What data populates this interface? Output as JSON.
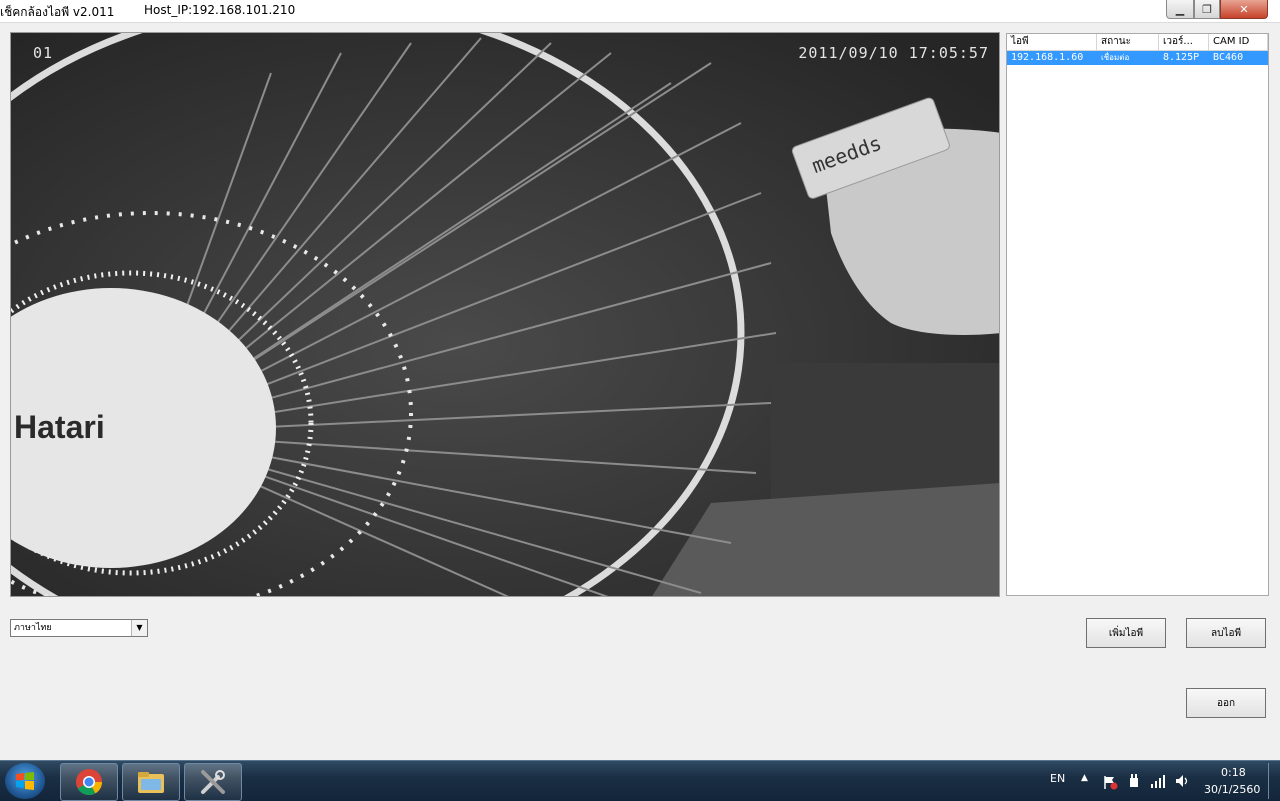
{
  "window": {
    "title": "เช็คกล้องไอพี v2.011",
    "host": "Host_IP:192.168.101.210",
    "minimize_glyph": "▁",
    "maximize_glyph": "❐",
    "close_glyph": "✕"
  },
  "video": {
    "channel": "01",
    "timestamp": "2011/09/10  17:05:57",
    "brand_text": "Hatari",
    "tag_text": "meedds"
  },
  "camera_list": {
    "columns": [
      "ไอพี",
      "สถานะ",
      "เวอร์...",
      "CAM ID"
    ],
    "rows": [
      {
        "ip": "192.168.1.60",
        "status": "เชื่อมต่อ",
        "version": "8.125P",
        "cam_id": "BC460"
      }
    ]
  },
  "language_select": {
    "value": "ภาษาไทย",
    "arrow": "▼"
  },
  "buttons": {
    "add": "เพิ่มไอพี",
    "delete": "ลบไอพี",
    "exit": "ออก"
  },
  "taskbar": {
    "items": [
      "start-button",
      "chrome",
      "file-explorer",
      "tools"
    ],
    "lang": "EN",
    "time": "0:18",
    "date": "30/1/2560",
    "tray_arrow": "▲"
  }
}
